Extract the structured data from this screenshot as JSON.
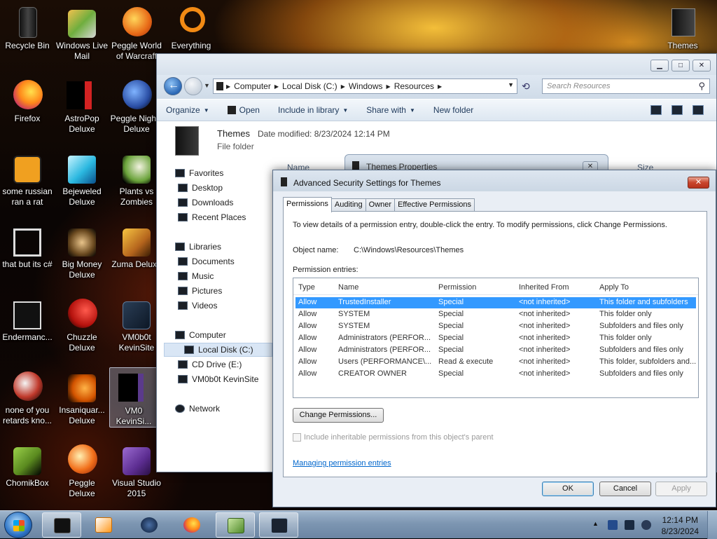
{
  "desktop": {
    "icons": [
      {
        "label": "Recycle Bin",
        "icon": "recycle-bin-icon"
      },
      {
        "label": "Windows Live Mail",
        "icon": "mail-icon"
      },
      {
        "label": "Peggle World of Warcraft",
        "icon": "peggle-wow-icon"
      },
      {
        "label": "Everything",
        "icon": "everything-search-icon"
      },
      {
        "label": "Firefox",
        "icon": "firefox-icon"
      },
      {
        "label": "AstroPop Deluxe",
        "icon": "astropop-icon"
      },
      {
        "label": "Peggle Nights Deluxe",
        "icon": "peggle-nights-icon"
      },
      {
        "label": "some russian ran a rat",
        "icon": "rat-app-icon"
      },
      {
        "label": "Bejeweled Deluxe",
        "icon": "bejeweled-icon"
      },
      {
        "label": "Plants vs Zombies",
        "icon": "plants-vs-zombies-icon"
      },
      {
        "label": "that but its c#",
        "icon": "csharp-app-icon"
      },
      {
        "label": "Big Money Deluxe",
        "icon": "big-money-icon"
      },
      {
        "label": "Zuma Deluxe",
        "icon": "zuma-icon"
      },
      {
        "label": "Endermanc...",
        "icon": "enderman-icon"
      },
      {
        "label": "Chuzzle Deluxe",
        "icon": "chuzzle-icon"
      },
      {
        "label": "VM0b0t KevinSite",
        "icon": "vmbot-icon"
      },
      {
        "label": "none of you retards kno...",
        "icon": "shortcut-icon"
      },
      {
        "label": "Insaniquar... Deluxe",
        "icon": "insaniquarium-icon"
      },
      {
        "label": "VM0 KevinSi...",
        "icon": "vm-folder-icon"
      },
      {
        "label": "ChomikBox",
        "icon": "chomikbox-icon"
      },
      {
        "label": "Peggle Deluxe",
        "icon": "peggle-icon"
      },
      {
        "label": "Visual Studio 2015",
        "icon": "visual-studio-icon"
      },
      {
        "label": "Themes",
        "icon": "themes-folder-icon"
      }
    ]
  },
  "explorer": {
    "address": [
      "Computer",
      "Local Disk (C:)",
      "Windows",
      "Resources"
    ],
    "search_placeholder": "Search Resources",
    "toolbar": {
      "organize": "Organize",
      "open": "Open",
      "include": "Include in library",
      "share": "Share with",
      "new_folder": "New folder"
    },
    "details": {
      "name": "Themes",
      "modified_label": "Date modified:",
      "modified_value": "8/23/2024 12:14 PM",
      "type": "File folder"
    },
    "columns": {
      "name": "Name",
      "size": "Size"
    },
    "nav": {
      "favorites": "Favorites",
      "desktop": "Desktop",
      "downloads": "Downloads",
      "recent": "Recent Places",
      "libraries": "Libraries",
      "documents": "Documents",
      "music": "Music",
      "pictures": "Pictures",
      "videos": "Videos",
      "computer": "Computer",
      "local_disk": "Local Disk (C:)",
      "cd_drive": "CD Drive (E:)",
      "vm_drive": "VM0b0t KevinSite",
      "network": "Network"
    }
  },
  "themes_properties": {
    "title": "Themes Properties",
    "close": "✕"
  },
  "dialog": {
    "title": "Advanced Security Settings for Themes",
    "close": "✕",
    "tabs": [
      "Permissions",
      "Auditing",
      "Owner",
      "Effective Permissions"
    ],
    "intro": "To view details of a permission entry, double-click the entry. To modify permissions, click Change Permissions.",
    "object_name_label": "Object name:",
    "object_name_value": "C:\\Windows\\Resources\\Themes",
    "entries_label": "Permission entries:",
    "columns": [
      "Type",
      "Name",
      "Permission",
      "Inherited From",
      "Apply To"
    ],
    "rows": [
      [
        "Allow",
        "TrustedInstaller",
        "Special",
        "<not inherited>",
        "This folder and subfolders"
      ],
      [
        "Allow",
        "SYSTEM",
        "Special",
        "<not inherited>",
        "This folder only"
      ],
      [
        "Allow",
        "SYSTEM",
        "Special",
        "<not inherited>",
        "Subfolders and files only"
      ],
      [
        "Allow",
        "Administrators (PERFOR...",
        "Special",
        "<not inherited>",
        "This folder only"
      ],
      [
        "Allow",
        "Administrators (PERFOR...",
        "Special",
        "<not inherited>",
        "Subfolders and files only"
      ],
      [
        "Allow",
        "Users (PERFORMANCE\\...",
        "Read & execute",
        "<not inherited>",
        "This folder, subfolders and..."
      ],
      [
        "Allow",
        "CREATOR OWNER",
        "Special",
        "<not inherited>",
        "Subfolders and files only"
      ]
    ],
    "change_button": "Change Permissions...",
    "include_checkbox": "Include inheritable permissions from this object's parent",
    "link": "Managing permission entries",
    "ok": "OK",
    "cancel": "Cancel",
    "apply": "Apply"
  },
  "taskbar": {
    "time": "12:14 PM",
    "date": "8/23/2024"
  }
}
